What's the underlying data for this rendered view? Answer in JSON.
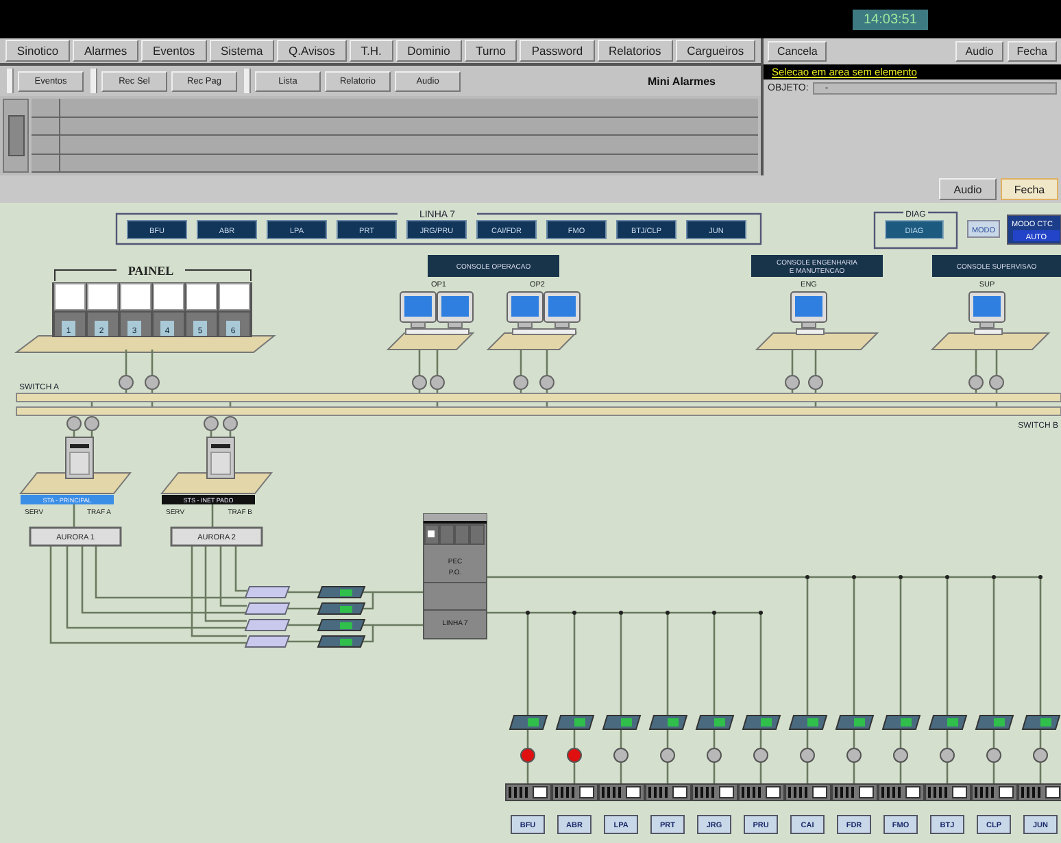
{
  "clock": "14:03:51",
  "menu": [
    {
      "label": "Sinotico"
    },
    {
      "label": "Alarmes"
    },
    {
      "label": "Eventos"
    },
    {
      "label": "Sistema"
    },
    {
      "label": "Q.Avisos"
    },
    {
      "label": "T.H."
    },
    {
      "label": "Dominio"
    },
    {
      "label": "Turno"
    },
    {
      "label": "Password"
    },
    {
      "label": "Relatorios"
    },
    {
      "label": "Cargueiros"
    }
  ],
  "toolbar_groups": [
    [
      "Eventos"
    ],
    [
      "Rec Sel",
      "Rec Pag"
    ],
    [
      "Lista",
      "Relatorio",
      "Audio"
    ]
  ],
  "mini_alarms_title": "Mini Alarmes",
  "selection_panel": {
    "buttons": [
      "Cancela",
      "Audio",
      "Fecha"
    ],
    "message": "Selecao em area sem elemento",
    "object_label": "OBJETO:",
    "object_value": "-"
  },
  "bottom_buttons": [
    {
      "label": "Audio",
      "selected": false
    },
    {
      "label": "Fecha",
      "selected": true
    }
  ],
  "diagram": {
    "line_group": {
      "title": "LINHA 7",
      "buttons": [
        "BFU",
        "ABR",
        "LPA",
        "PRT",
        "JRG/PRU",
        "CAI/FDR",
        "FMO",
        "BTJ/CLP",
        "JUN"
      ]
    },
    "diag": {
      "title": "DIAG",
      "button": "DIAG"
    },
    "mode_button": "MODO",
    "ctc": {
      "title": "MODO CTC",
      "value": "AUTO"
    },
    "panel": {
      "title": "PAINEL",
      "slots": [
        "1",
        "2",
        "3",
        "4",
        "5",
        "6"
      ]
    },
    "consoles": [
      {
        "title": [
          "CONSOLE OPERACAO"
        ],
        "stations": [
          "OP1",
          "OP2"
        ]
      },
      {
        "title": [
          "CONSOLE ENGENHARIA",
          "E MANUTENCAO"
        ],
        "stations": [
          "ENG"
        ]
      },
      {
        "title": [
          "CONSOLE SUPERVISAO"
        ],
        "stations": [
          "SUP"
        ]
      }
    ],
    "switches": [
      "SWITCH A",
      "SWITCH B"
    ],
    "servers": [
      {
        "name": "STA - PRINCIPAL",
        "active": true,
        "left": "SERV",
        "right": "TRAF A",
        "router": "AURORA 1"
      },
      {
        "name": "STS - INET PADO",
        "active": false,
        "left": "SERV",
        "right": "TRAF B",
        "router": "AURORA 2"
      }
    ],
    "cabinet": {
      "labels": [
        "PEC",
        "P.O."
      ],
      "line": "LINHA 7"
    },
    "stations": [
      {
        "code": "BFU",
        "alarm": true
      },
      {
        "code": "ABR",
        "alarm": true
      },
      {
        "code": "LPA",
        "alarm": false
      },
      {
        "code": "PRT",
        "alarm": false
      },
      {
        "code": "JRG",
        "alarm": false
      },
      {
        "code": "PRU",
        "alarm": false
      },
      {
        "code": "CAI",
        "alarm": false
      },
      {
        "code": "FDR",
        "alarm": false
      },
      {
        "code": "FMO",
        "alarm": false
      },
      {
        "code": "BTJ",
        "alarm": false
      },
      {
        "code": "CLP",
        "alarm": false
      },
      {
        "code": "JUN",
        "alarm": false
      }
    ]
  }
}
